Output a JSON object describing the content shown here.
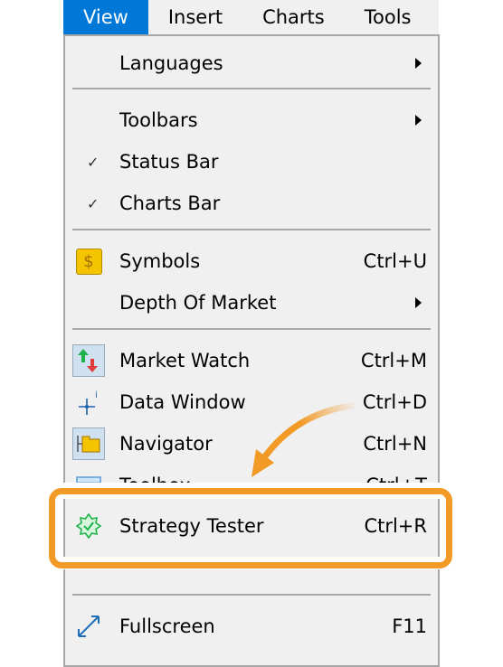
{
  "menubar": [
    "View",
    "Insert",
    "Charts",
    "Tools"
  ],
  "menu": {
    "languages": "Languages",
    "toolbars": "Toolbars",
    "status_bar": "Status Bar",
    "charts_bar": "Charts Bar",
    "symbols": {
      "label": "Symbols",
      "shortcut": "Ctrl+U"
    },
    "depth": "Depth Of Market",
    "market_watch": {
      "label": "Market Watch",
      "shortcut": "Ctrl+M"
    },
    "data_window": {
      "label": "Data Window",
      "shortcut": "Ctrl+D"
    },
    "navigator": {
      "label": "Navigator",
      "shortcut": "Ctrl+N"
    },
    "toolbox": {
      "label": "Toolbox",
      "shortcut": "Ctrl+T"
    },
    "strategy_tester": {
      "label": "Strategy Tester",
      "shortcut": "Ctrl+R"
    },
    "fullscreen": {
      "label": "Fullscreen",
      "shortcut": "F11"
    }
  },
  "colors": {
    "accent": "#0078d7",
    "highlight": "#f29a26"
  }
}
